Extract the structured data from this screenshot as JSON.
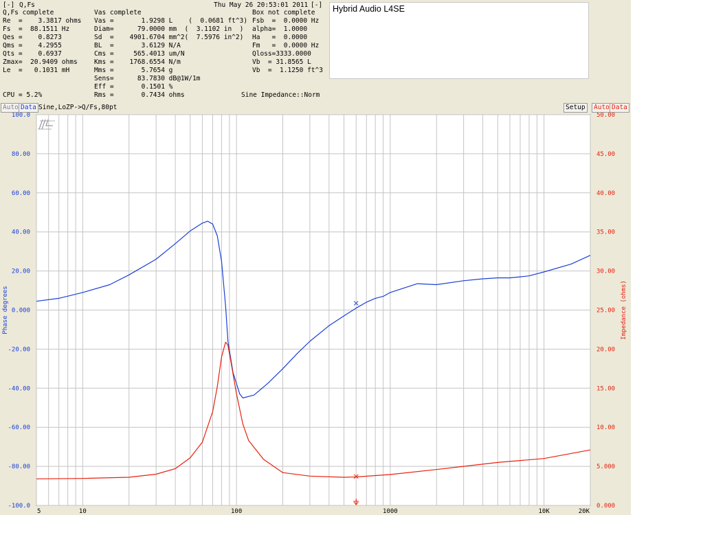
{
  "header": {
    "menu_left": "[-]",
    "menu_right": "[-]",
    "col1_title": "Q,Fs",
    "col1_status": "Q,Fs complete",
    "col1_rows": [
      "Re  =    3.3817 ohms",
      "Fs  =  88.1511 Hz",
      "Qes =    0.8273",
      "Qms =    4.2955",
      "Qts =    0.6937",
      "Zmax=  20.9409 ohms",
      "Le  =   0.1031 mH"
    ],
    "cpu": "CPU = 5.2%",
    "col2_status": "Vas complete",
    "col2_rows": [
      "Vas =       1.9298 L    (  0.0681 ft^3)",
      "Diam=      79.0000 mm  (  3.1102 in  )",
      "Sd  =    4901.6704 mm^2(  7.5976 in^2)",
      "BL  =       3.6129 N/A",
      "Cms =     565.4013 um/N",
      "Kms =    1768.6554 N/m",
      "Mms =       5.7654 g",
      "Sens=      83.7830 dB@1W/1m",
      "Eff =       0.1501 %",
      "Rms =       0.7434 ohms"
    ],
    "datetime": "Thu May 26 20:53:01 2011",
    "col3_status": "Box not complete",
    "col3_rows": [
      "Fsb  =  0.0000 Hz",
      "alpha=  1.0000",
      "Ha   =  0.0000",
      "Fm   =  0.0000 Hz",
      "Qloss=3333.0000",
      "",
      "Vb  = 31.8565 L",
      "Vb  =  1.1250 ft^3"
    ],
    "mode_text": "Sine Impedance::Norm"
  },
  "notes": {
    "text": "Hybrid Audio L4SE"
  },
  "controls": {
    "auto_left": "Auto",
    "data_left": "Data",
    "sweep_label": "Sine,LoZP->Q/Fs,80pt",
    "setup": "Setup",
    "auto_right": "Auto",
    "data_right": "Data"
  },
  "colors": {
    "phase": "#1a3fd6",
    "impedance": "#e8200e",
    "grid": "#c4c4c4",
    "panel": "#ece9d8",
    "plot_bg": "#ffffff"
  },
  "chart_data": {
    "type": "line",
    "x_scale": "log",
    "xlim": [
      5,
      20000
    ],
    "x_tick_labels": [
      "5",
      "10",
      "100",
      "1000",
      "10K",
      "20K"
    ],
    "x_tick_values": [
      5,
      10,
      100,
      1000,
      10000,
      20000
    ],
    "y_left": {
      "label": "Phase degrees",
      "ylim": [
        -100,
        100
      ],
      "ticks": [
        "100.0",
        "80.00",
        "60.00",
        "40.00",
        "20.00",
        "0.000",
        "-20.00",
        "-40.00",
        "-60.00",
        "-80.00",
        "-100.0"
      ]
    },
    "y_right": {
      "label": "Impedance (ohms)",
      "ylim": [
        0,
        50
      ],
      "ticks": [
        "50.00",
        "45.00",
        "40.00",
        "35.00",
        "30.00",
        "25.00",
        "20.00",
        "15.00",
        "10.00",
        "5.000",
        "0.000"
      ]
    },
    "grid": true,
    "series": [
      {
        "axis": "left",
        "x": [
          5,
          7,
          10,
          15,
          20,
          30,
          40,
          50,
          60,
          65,
          70,
          75,
          80,
          85,
          88,
          95,
          105,
          110,
          130,
          160,
          200,
          250,
          300,
          400,
          500,
          600,
          700,
          800,
          900,
          1000,
          1500,
          2000,
          3000,
          4000,
          5000,
          6000,
          7000,
          8000,
          10000,
          15000,
          20000
        ],
        "values": [
          4.5,
          6,
          9,
          13,
          18,
          26,
          34,
          40.5,
          44.5,
          45.5,
          44,
          38,
          25,
          2,
          -16,
          -32,
          -43,
          -45,
          -43.5,
          -37.5,
          -30,
          -22,
          -16,
          -8,
          -3,
          1,
          4,
          6,
          7,
          9,
          13.5,
          13,
          15,
          16,
          16.5,
          16.5,
          17,
          17.5,
          19.5,
          23.5,
          28
        ]
      },
      {
        "axis": "right",
        "x": [
          5,
          10,
          20,
          30,
          40,
          50,
          60,
          70,
          75,
          80,
          85,
          88,
          92,
          100,
          110,
          120,
          150,
          200,
          300,
          500,
          600,
          1000,
          2000,
          3000,
          5000,
          10000,
          20000
        ],
        "values": [
          3.4,
          3.45,
          3.6,
          4.0,
          4.7,
          6.1,
          8.1,
          12.0,
          15.2,
          19.0,
          20.9,
          20.5,
          18.4,
          14.3,
          10.4,
          8.3,
          5.9,
          4.2,
          3.75,
          3.6,
          3.65,
          3.95,
          4.6,
          5.0,
          5.5,
          6.0,
          7.1
        ]
      }
    ],
    "markers": [
      {
        "axis": "left",
        "symbol": "x",
        "x": 600,
        "value": 3.5
      },
      {
        "axis": "right",
        "symbol": "x",
        "x": 600,
        "value": 3.7
      }
    ],
    "logo": "SL"
  }
}
